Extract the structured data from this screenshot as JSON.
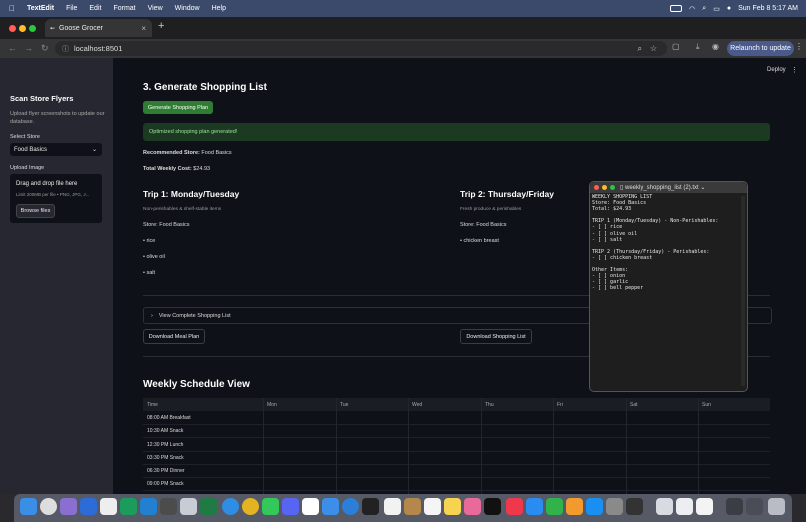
{
  "menubar": {
    "app": "TextEdit",
    "items": [
      "File",
      "Edit",
      "Format",
      "View",
      "Window",
      "Help"
    ],
    "clock": "Sun Feb 8  5:17 AM"
  },
  "browser": {
    "tab_title": "Goose Grocer",
    "url": "localhost:8501",
    "relaunch_label": "Relaunch to update"
  },
  "sidebar": {
    "title": "Scan Store Flyers",
    "description": "Upload flyer screenshots to update our database.",
    "select_label": "Select Store",
    "select_value": "Food Basics",
    "upload_label": "Upload Image",
    "drop_title": "Drag and drop file here",
    "drop_limit": "Limit 200MB per file • PNG, JPG, J...",
    "browse_label": "Browse files"
  },
  "header": {
    "deploy": "Deploy"
  },
  "main": {
    "section_title": "3. Generate Shopping List",
    "generate_button": "Generate Shopping Plan",
    "success_message": "Optimized shopping plan generated!",
    "recommended_label": "Recommended Store:",
    "recommended_value": "Food Basics",
    "total_label": "Total Weekly Cost:",
    "total_value": "$24.93",
    "trip1": {
      "title": "Trip 1: Monday/Tuesday",
      "subtitle": "Non-perishables & shelf-stable items",
      "store_label": "Store:",
      "store_value": "Food Basics",
      "items": [
        "• rice",
        "• olive oil",
        "• salt"
      ]
    },
    "trip2": {
      "title": "Trip 2: Thursday/Friday",
      "subtitle": "Fresh produce & perishables",
      "store_label": "Store:",
      "store_value": "Food Basics",
      "items": [
        "• chicken breast"
      ]
    },
    "expander_label": "View Complete Shopping List",
    "download_meal_plan": "Download Meal Plan",
    "download_shopping_list": "Download Shopping List",
    "schedule_title": "Weekly Schedule View",
    "schedule": {
      "columns": [
        "Time",
        "Mon",
        "Tue",
        "Wed",
        "Thu",
        "Fri",
        "Sat",
        "Sun"
      ],
      "rows": [
        "08:00 AM Breakfast",
        "10:30 AM Snack",
        "12:30 PM Lunch",
        "03:30 PM Snack",
        "06:30 PM Dinner",
        "09:00 PM Snack"
      ]
    }
  },
  "textfile": {
    "title": "weekly_shopping_list (2).txt",
    "content": "WEEKLY SHOPPING LIST\nStore: Food Basics\nTotal: $24.93\n\nTRIP 1 (Monday/Tuesday) - Non-Perishables:\n- [ ] rice\n- [ ] olive oil\n- [ ] salt\n\nTRIP 2 (Thursday/Friday) - Perishables:\n- [ ] chicken breast\n\nOther Items:\n- [ ] onion\n- [ ] garlic\n- [ ] bell pepper"
  },
  "colors": {
    "menubar": "#3b4a6b",
    "app_bg": "#0e1117",
    "sidebar_bg": "#262730",
    "primary_button": "#2e7d32",
    "success_bg": "#1c3a22"
  }
}
